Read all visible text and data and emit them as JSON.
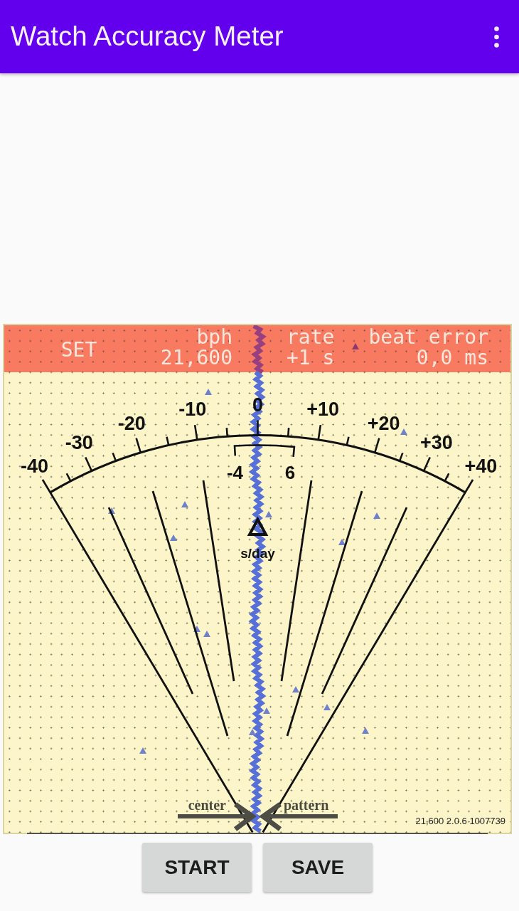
{
  "app_bar": {
    "title": "Watch Accuracy Meter"
  },
  "meter": {
    "status_band": {
      "mode": "SET",
      "bph_label": "bph",
      "bph_value": "21,600",
      "rate_label": "rate",
      "rate_value": "+1 s",
      "beat_error_label": "beat error",
      "beat_error_value": "0,0 ms"
    },
    "scale_labels": [
      "-40",
      "-30",
      "-20",
      "-10",
      "0",
      "+10",
      "+20",
      "+30",
      "+40"
    ],
    "tolerance": {
      "low": "-4",
      "high": "6"
    },
    "unit": "s/day",
    "guides": [
      {
        "label": "center"
      },
      {
        "label": "pattern"
      }
    ],
    "version": "21,600 2.0.6 1007739"
  },
  "buttons": [
    {
      "label": "START"
    },
    {
      "label": "SAVE"
    }
  ]
}
